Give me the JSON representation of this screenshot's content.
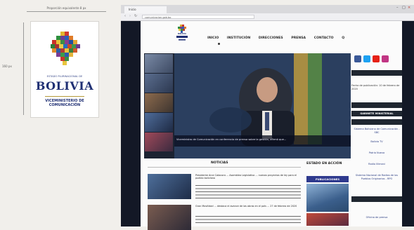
{
  "spec": {
    "width_label": "Proporción equivalente 8 px",
    "height_label": "160 px"
  },
  "logo": {
    "gov_text": "ESTADO PLURINACIONAL DE",
    "country": "BOLIVIA",
    "vice_line1": "VICEMINISTERIO DE",
    "vice_line2": "COMUNICACIÓN"
  },
  "browser": {
    "tab_title": "Inicio",
    "address": "comunicacion.gob.bo"
  },
  "site": {
    "logo_caption": "BOLIVIA",
    "nav": [
      "INICIO",
      "INSTITUCIÓN",
      "DIRECCIONES",
      "PRENSA",
      "CONTACTO",
      "Q"
    ],
    "hero_caption": "Viceministro de Comunicación en conferencia de prensa sobre la gestión, afirmó que...",
    "news_title": "NOTICIAS",
    "news": [
      {
        "headline": "Presidente Arce Catacora ... Asamblea Legislativa ... nuevos proyectos de ley para el pueblo boliviano"
      },
      {
        "headline": "Gran Movilidad ... destaca el avance de las obras en el país ... 27 de febrero de 2020"
      }
    ],
    "state_action_title": "ESTADO EN ACCIÓN",
    "publications_title": "PUBLICACIONES",
    "sidebar": {
      "date_text": "Fecha de publicación: 10 de febrero de 2020",
      "gabinete": "GABINETE MINISTERIAL",
      "items": [
        "Sistema Boliviano de Comunicación - SBC",
        "Bolivia TV",
        "Patria Nueva",
        "Radio Illimani",
        "Sistema Nacional de Radios de los Pueblos Originarios - RPO",
        "Oficina de prensa"
      ]
    },
    "social": [
      {
        "icon": "facebook-icon",
        "color": "#3b5998"
      },
      {
        "icon": "twitter-icon",
        "color": "#1da1f2"
      },
      {
        "icon": "youtube-icon",
        "color": "#e62117"
      },
      {
        "icon": "instagram-icon",
        "color": "#c13584"
      }
    ]
  }
}
